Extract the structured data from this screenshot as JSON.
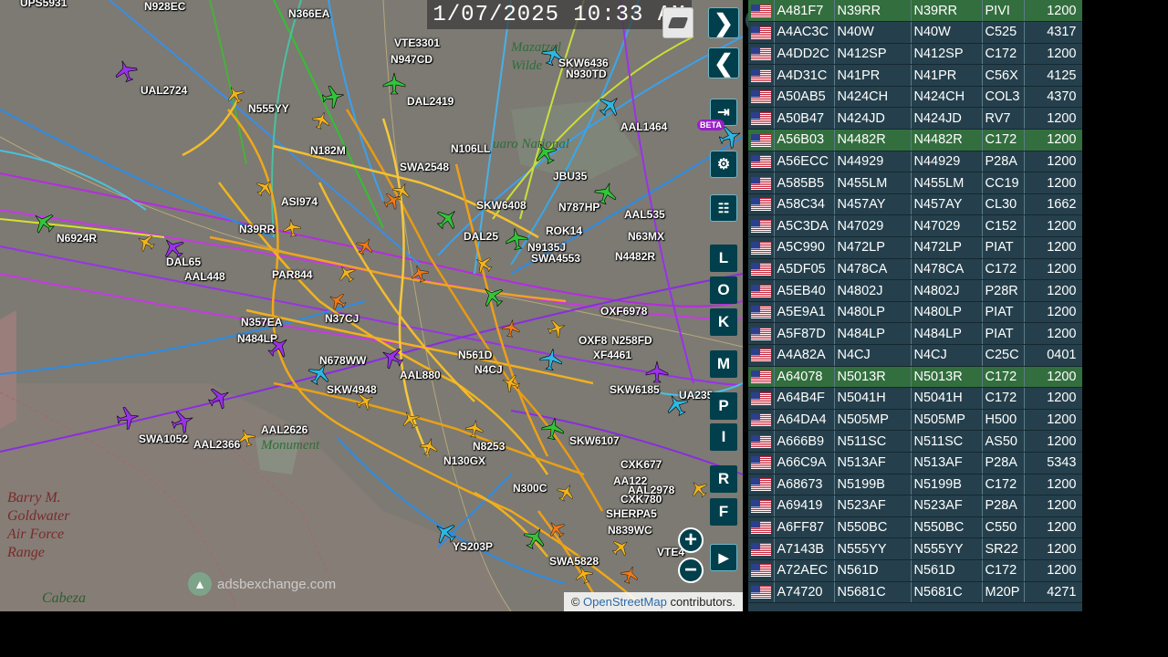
{
  "clock": "1/07/2025 10:33 AM",
  "map": {
    "place_labels": [
      {
        "name": "goldwater-range",
        "text": "Barry M.\nGoldwater\nAir Force\nRange",
        "cls": "place"
      },
      {
        "name": "cabeza",
        "text": "Cabeza",
        "cls": "place terrain"
      },
      {
        "name": "monument",
        "text": "Monument",
        "cls": "place park"
      },
      {
        "name": "saguaro",
        "text": "uaro National",
        "cls": "place park"
      },
      {
        "name": "maricopa-wild",
        "text": "Mazatzal\nWilde",
        "cls": "place park"
      }
    ],
    "flight_labels": [
      "UPS5931",
      "N928EC",
      "N366EA",
      "VTE3301",
      "N947CD",
      "SKW6436",
      "N930TD",
      "UAL2724",
      "N555YY",
      "DAL2419",
      "N106LL",
      "AAL1464",
      "N182M",
      "SWA2548",
      "JBU35",
      "ASI974",
      "N6924R",
      "N39RR",
      "N787HP",
      "AAL535",
      "SKW6408",
      "N63MX",
      "N9135J",
      "SWA4553",
      "N4482R",
      "AAL448",
      "PAR844",
      "N37CJ",
      "OXF6978",
      "N357EA",
      "N258FD",
      "N484LP",
      "N678WW",
      "N561D",
      "XF4461",
      "AAL880",
      "SKW4948",
      "SKW6185",
      "UA235",
      "SWA1052",
      "AAL2366",
      "AAL2626",
      "N130GX",
      "N8253",
      "CXK677",
      "AAL2978",
      "CXK780",
      "N300C",
      "SHERPA5",
      "N839WC",
      "YS203P",
      "SWA5828",
      "VTE4",
      "OXF8",
      "SKW6107",
      "DAL25",
      "DAL65",
      "ROK14",
      "N4CJ",
      "AA122"
    ],
    "watermark": "adsbexchange.com",
    "attribution_prefix": "©",
    "attribution_link": "OpenStreetMap",
    "attribution_suffix": "contributors.",
    "beta_badge": "BETA",
    "letter_buttons": [
      "L",
      "O",
      "K",
      "M",
      "P",
      "I",
      "R",
      "F"
    ],
    "zoom_in": "+",
    "zoom_out": "−"
  },
  "table": {
    "rows": [
      {
        "hex": "A481F7",
        "reg": "N39RR",
        "call": "N39RR",
        "type": "PIVI",
        "alt": "1200",
        "hl": true
      },
      {
        "hex": "A4AC3C",
        "reg": "N40W",
        "call": "N40W",
        "type": "C525",
        "alt": "4317",
        "hl": false
      },
      {
        "hex": "A4DD2C",
        "reg": "N412SP",
        "call": "N412SP",
        "type": "C172",
        "alt": "1200",
        "hl": false
      },
      {
        "hex": "A4D31C",
        "reg": "N41PR",
        "call": "N41PR",
        "type": "C56X",
        "alt": "4125",
        "hl": false
      },
      {
        "hex": "A50AB5",
        "reg": "N424CH",
        "call": "N424CH",
        "type": "COL3",
        "alt": "4370",
        "hl": false
      },
      {
        "hex": "A50B47",
        "reg": "N424JD",
        "call": "N424JD",
        "type": "RV7",
        "alt": "1200",
        "hl": false
      },
      {
        "hex": "A56B03",
        "reg": "N4482R",
        "call": "N4482R",
        "type": "C172",
        "alt": "1200",
        "hl": true
      },
      {
        "hex": "A56ECC",
        "reg": "N44929",
        "call": "N44929",
        "type": "P28A",
        "alt": "1200",
        "hl": false
      },
      {
        "hex": "A585B5",
        "reg": "N455LM",
        "call": "N455LM",
        "type": "CC19",
        "alt": "1200",
        "hl": false
      },
      {
        "hex": "A58C34",
        "reg": "N457AY",
        "call": "N457AY",
        "type": "CL30",
        "alt": "1662",
        "hl": false
      },
      {
        "hex": "A5C3DA",
        "reg": "N47029",
        "call": "N47029",
        "type": "C152",
        "alt": "1200",
        "hl": false
      },
      {
        "hex": "A5C990",
        "reg": "N472LP",
        "call": "N472LP",
        "type": "PIAT",
        "alt": "1200",
        "hl": false
      },
      {
        "hex": "A5DF05",
        "reg": "N478CA",
        "call": "N478CA",
        "type": "C172",
        "alt": "1200",
        "hl": false
      },
      {
        "hex": "A5EB40",
        "reg": "N4802J",
        "call": "N4802J",
        "type": "P28R",
        "alt": "1200",
        "hl": false
      },
      {
        "hex": "A5E9A1",
        "reg": "N480LP",
        "call": "N480LP",
        "type": "PIAT",
        "alt": "1200",
        "hl": false
      },
      {
        "hex": "A5F87D",
        "reg": "N484LP",
        "call": "N484LP",
        "type": "PIAT",
        "alt": "1200",
        "hl": false
      },
      {
        "hex": "A4A82A",
        "reg": "N4CJ",
        "call": "N4CJ",
        "type": "C25C",
        "alt": "0401",
        "hl": false
      },
      {
        "hex": "A64078",
        "reg": "N5013R",
        "call": "N5013R",
        "type": "C172",
        "alt": "1200",
        "hl": true
      },
      {
        "hex": "A64B4F",
        "reg": "N5041H",
        "call": "N5041H",
        "type": "C172",
        "alt": "1200",
        "hl": false
      },
      {
        "hex": "A64DA4",
        "reg": "N505MP",
        "call": "N505MP",
        "type": "H500",
        "alt": "1200",
        "hl": false
      },
      {
        "hex": "A666B9",
        "reg": "N511SC",
        "call": "N511SC",
        "type": "AS50",
        "alt": "1200",
        "hl": false
      },
      {
        "hex": "A66C9A",
        "reg": "N513AF",
        "call": "N513AF",
        "type": "P28A",
        "alt": "5343",
        "hl": false
      },
      {
        "hex": "A68673",
        "reg": "N5199B",
        "call": "N5199B",
        "type": "C172",
        "alt": "1200",
        "hl": false
      },
      {
        "hex": "A69419",
        "reg": "N523AF",
        "call": "N523AF",
        "type": "P28A",
        "alt": "1200",
        "hl": false
      },
      {
        "hex": "A6FF87",
        "reg": "N550BC",
        "call": "N550BC",
        "type": "C550",
        "alt": "1200",
        "hl": false
      },
      {
        "hex": "A7143B",
        "reg": "N555YY",
        "call": "N555YY",
        "type": "SR22",
        "alt": "1200",
        "hl": false
      },
      {
        "hex": "A72AEC",
        "reg": "N561D",
        "call": "N561D",
        "type": "C172",
        "alt": "1200",
        "hl": false
      },
      {
        "hex": "A74720",
        "reg": "N5681C",
        "call": "N5681C",
        "type": "M20P",
        "alt": "4271",
        "hl": false
      }
    ]
  },
  "colors": {
    "map_bg": "#7c7a73",
    "panel_bg": "#25404c",
    "highlight": "#336e3e",
    "button_bg": "#003f4b"
  }
}
